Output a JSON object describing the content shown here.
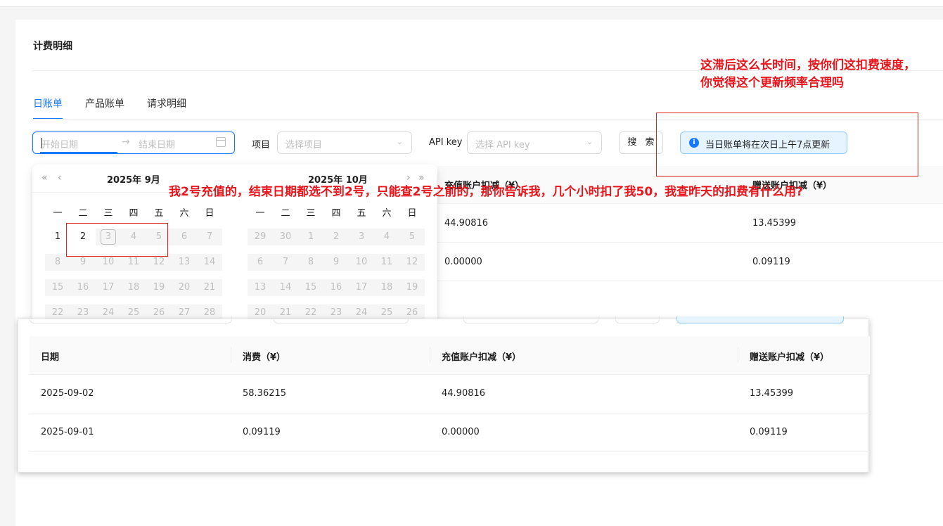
{
  "page": {
    "title": "计费明细"
  },
  "tabs": [
    {
      "label": "日账单",
      "active": true
    },
    {
      "label": "产品账单",
      "active": false
    },
    {
      "label": "请求明细",
      "active": false
    }
  ],
  "filters": {
    "start_placeholder": "开始日期",
    "range_arrow": "→",
    "end_placeholder": "结束日期",
    "project_label": "项目",
    "project_placeholder": "选择项目",
    "apikey_label": "API key",
    "apikey_placeholder": "选择 API key",
    "search_label": "搜 索",
    "notice_icon": "i",
    "notice_text": "当日账单将在次日上午7点更新"
  },
  "calendar": {
    "nav_prev_year": "«",
    "nav_prev_month": "‹",
    "nav_next_month": "›",
    "nav_next_year": "»",
    "left_title": "2025年  9月",
    "right_title": "2025年  10月",
    "weekdays": [
      "一",
      "二",
      "三",
      "四",
      "五",
      "六",
      "日"
    ],
    "left_rows": [
      [
        "1",
        "2",
        "3",
        "4",
        "5",
        "6",
        "7"
      ],
      [
        "8",
        "9",
        "10",
        "11",
        "12",
        "13",
        "14"
      ],
      [
        "15",
        "16",
        "17",
        "18",
        "19",
        "20",
        "21"
      ],
      [
        "22",
        "23",
        "24",
        "25",
        "26",
        "27",
        "28"
      ]
    ],
    "right_rows": [
      [
        "29",
        "30",
        "1",
        "2",
        "3",
        "4",
        "5"
      ],
      [
        "6",
        "7",
        "8",
        "9",
        "10",
        "11",
        "12"
      ],
      [
        "13",
        "14",
        "15",
        "16",
        "17",
        "18",
        "19"
      ],
      [
        "20",
        "21",
        "22",
        "23",
        "24",
        "25",
        "26"
      ]
    ],
    "today": "3"
  },
  "background_table": {
    "headers": [
      "充值账户扣减（¥）",
      "赠送账户扣减（¥）"
    ],
    "rows": [
      [
        "44.90816",
        "13.45399"
      ],
      [
        "0.00000",
        "0.09119"
      ]
    ]
  },
  "table": {
    "headers": [
      "日期",
      "消费（¥）",
      "充值账户扣减（¥）",
      "赠送账户扣减（¥）"
    ],
    "rows": [
      [
        "2025-09-02",
        "58.36215",
        "44.90816",
        "13.45399"
      ],
      [
        "2025-09-01",
        "0.09119",
        "0.00000",
        "0.09119"
      ]
    ]
  },
  "annotations": {
    "top_right_line1": "这滞后这么长时间，按你们这扣费速度，",
    "top_right_line2": "你觉得这个更新频率合理吗",
    "middle": "我2号充值的，结束日期都选不到2号，只能查2号之前的，那你告诉我，几个小时扣了我50，我查昨天的扣费有什么用?"
  },
  "colors": {
    "accent": "#1677ff",
    "annotation_red": "#e8161c"
  }
}
